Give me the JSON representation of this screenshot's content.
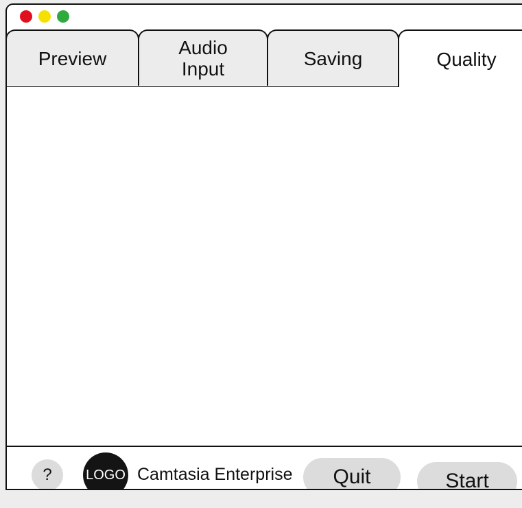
{
  "window": {
    "traffic_lights": [
      "close",
      "minimize",
      "maximize"
    ]
  },
  "tabs": [
    {
      "label": "Preview",
      "active": false
    },
    {
      "label": "Audio\nInput",
      "active": false
    },
    {
      "label": "Saving",
      "active": false
    },
    {
      "label": "Quality",
      "active": true
    }
  ],
  "footer": {
    "help_label": "?",
    "logo_text": "LOGO",
    "product_name": "Camtasia Enterprise",
    "quit_label": "Quit",
    "start_label": "Start"
  },
  "colors": {
    "close": "#e0101e",
    "minimize": "#f5e100",
    "maximize": "#2faa3f",
    "tab_inactive": "#ececec",
    "button_fill": "#dcdcdc",
    "logo_fill": "#141414"
  }
}
